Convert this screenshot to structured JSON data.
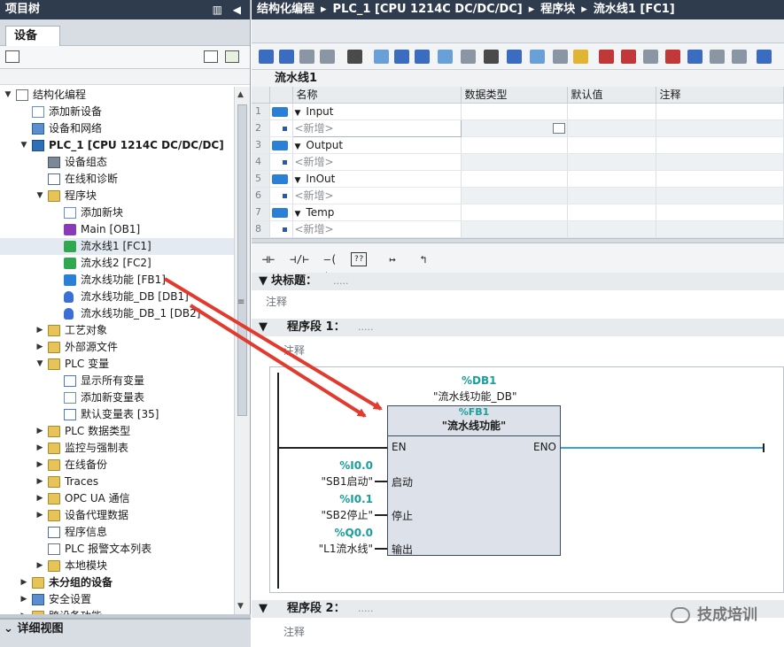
{
  "left": {
    "title": "项目树",
    "title_tools": "▥ ◀",
    "tab": "设备",
    "detail": "详细视图"
  },
  "tree": [
    {
      "label": "结构化编程",
      "level": 0,
      "arrow": "▼",
      "icon": "doc",
      "bold": false
    },
    {
      "label": "添加新设备",
      "level": 1,
      "arrow": "",
      "icon": "star",
      "bold": false
    },
    {
      "label": "设备和网络",
      "level": 1,
      "arrow": "",
      "icon": "net",
      "bold": false
    },
    {
      "label": "PLC_1 [CPU 1214C DC/DC/DC]",
      "level": 1,
      "arrow": "▼",
      "icon": "plc",
      "bold": true
    },
    {
      "label": "设备组态",
      "level": 2,
      "arrow": "",
      "icon": "cfg",
      "bold": false
    },
    {
      "label": "在线和诊断",
      "level": 2,
      "arrow": "",
      "icon": "diag",
      "bold": false
    },
    {
      "label": "程序块",
      "level": 2,
      "arrow": "▼",
      "icon": "folder",
      "bold": false
    },
    {
      "label": "添加新块",
      "level": 3,
      "arrow": "",
      "icon": "star",
      "bold": false
    },
    {
      "label": "Main [OB1]",
      "level": 3,
      "arrow": "",
      "icon": "ob",
      "bold": false
    },
    {
      "label": "流水线1 [FC1]",
      "level": 3,
      "arrow": "",
      "icon": "fc",
      "bold": false,
      "selected": true
    },
    {
      "label": "流水线2 [FC2]",
      "level": 3,
      "arrow": "",
      "icon": "fc",
      "bold": false
    },
    {
      "label": "流水线功能 [FB1]",
      "level": 3,
      "arrow": "",
      "icon": "fb",
      "bold": false
    },
    {
      "label": "流水线功能_DB [DB1]",
      "level": 3,
      "arrow": "",
      "icon": "db",
      "bold": false
    },
    {
      "label": "流水线功能_DB_1 [DB2]",
      "level": 3,
      "arrow": "",
      "icon": "db",
      "bold": false
    },
    {
      "label": "工艺对象",
      "level": 2,
      "arrow": "▶",
      "icon": "folder",
      "bold": false
    },
    {
      "label": "外部源文件",
      "level": 2,
      "arrow": "▶",
      "icon": "folder",
      "bold": false
    },
    {
      "label": "PLC 变量",
      "level": 2,
      "arrow": "▼",
      "icon": "folder",
      "bold": false
    },
    {
      "label": "显示所有变量",
      "level": 3,
      "arrow": "",
      "icon": "tag",
      "bold": false
    },
    {
      "label": "添加新变量表",
      "level": 3,
      "arrow": "",
      "icon": "star",
      "bold": false
    },
    {
      "label": "默认变量表 [35]",
      "level": 3,
      "arrow": "",
      "icon": "tag",
      "bold": false
    },
    {
      "label": "PLC 数据类型",
      "level": 2,
      "arrow": "▶",
      "icon": "folder",
      "bold": false
    },
    {
      "label": "监控与强制表",
      "level": 2,
      "arrow": "▶",
      "icon": "folder",
      "bold": false
    },
    {
      "label": "在线备份",
      "level": 2,
      "arrow": "▶",
      "icon": "folder",
      "bold": false
    },
    {
      "label": "Traces",
      "level": 2,
      "arrow": "▶",
      "icon": "folder",
      "bold": false
    },
    {
      "label": "OPC UA 通信",
      "level": 2,
      "arrow": "▶",
      "icon": "folder",
      "bold": false
    },
    {
      "label": "设备代理数据",
      "level": 2,
      "arrow": "▶",
      "icon": "folder",
      "bold": false
    },
    {
      "label": "程序信息",
      "level": 2,
      "arrow": "",
      "icon": "diag",
      "bold": false
    },
    {
      "label": "PLC 报警文本列表",
      "level": 2,
      "arrow": "",
      "icon": "doc",
      "bold": false
    },
    {
      "label": "本地模块",
      "level": 2,
      "arrow": "▶",
      "icon": "folder",
      "bold": false
    },
    {
      "label": "未分组的设备",
      "level": 1,
      "arrow": "▶",
      "icon": "folder",
      "bold": true
    },
    {
      "label": "安全设置",
      "level": 1,
      "arrow": "▶",
      "icon": "net",
      "bold": false
    },
    {
      "label": "跨设备功能",
      "level": 1,
      "arrow": "▶",
      "icon": "folder",
      "bold": false
    }
  ],
  "breadcrumb": [
    "结构化编程",
    "PLC_1 [CPU 1214C DC/DC/DC]",
    "程序块",
    "流水线1 [FC1]"
  ],
  "block_name": "流水线1",
  "iface": {
    "headers": [
      "名称",
      "数据类型",
      "默认值",
      "注释"
    ],
    "rows": [
      {
        "num": "1",
        "kind": "section",
        "name": "Input"
      },
      {
        "num": "2",
        "kind": "new",
        "name": "<新增>"
      },
      {
        "num": "3",
        "kind": "section",
        "name": "Output"
      },
      {
        "num": "4",
        "kind": "new",
        "name": "<新增>"
      },
      {
        "num": "5",
        "kind": "section",
        "name": "InOut"
      },
      {
        "num": "6",
        "kind": "new",
        "name": "<新增>"
      },
      {
        "num": "7",
        "kind": "section",
        "name": "Temp"
      },
      {
        "num": "8",
        "kind": "new",
        "name": "<新增>"
      }
    ]
  },
  "ladder_tools": [
    "⊣⊢",
    "⊣/⊢",
    "–( )–",
    "??",
    "↦",
    "↰"
  ],
  "block_title": {
    "label": "块标题：",
    "dots": "....."
  },
  "comment": "注释",
  "network1": {
    "label": "程序段 1：",
    "dots": "....."
  },
  "network2": {
    "label": "程序段 2：",
    "dots": "....."
  },
  "fb": {
    "db_addr": "%DB1",
    "db_name": "\"流水线功能_DB\"",
    "addr": "%FB1",
    "name": "\"流水线功能\"",
    "en": "EN",
    "eno": "ENO",
    "pins": [
      {
        "pin": "启动",
        "addr": "%I0.0",
        "tag": "\"SB1启动\""
      },
      {
        "pin": "停止",
        "addr": "%I0.1",
        "tag": "\"SB2停止\""
      },
      {
        "pin": "输出",
        "addr": "%Q0.0",
        "tag": "\"L1流水线\""
      }
    ]
  },
  "watermark": "技成培训",
  "colors": {
    "header_bg": "#2f3c4d",
    "operand": "#1b9f9b",
    "arrow": "#e23b2e"
  }
}
